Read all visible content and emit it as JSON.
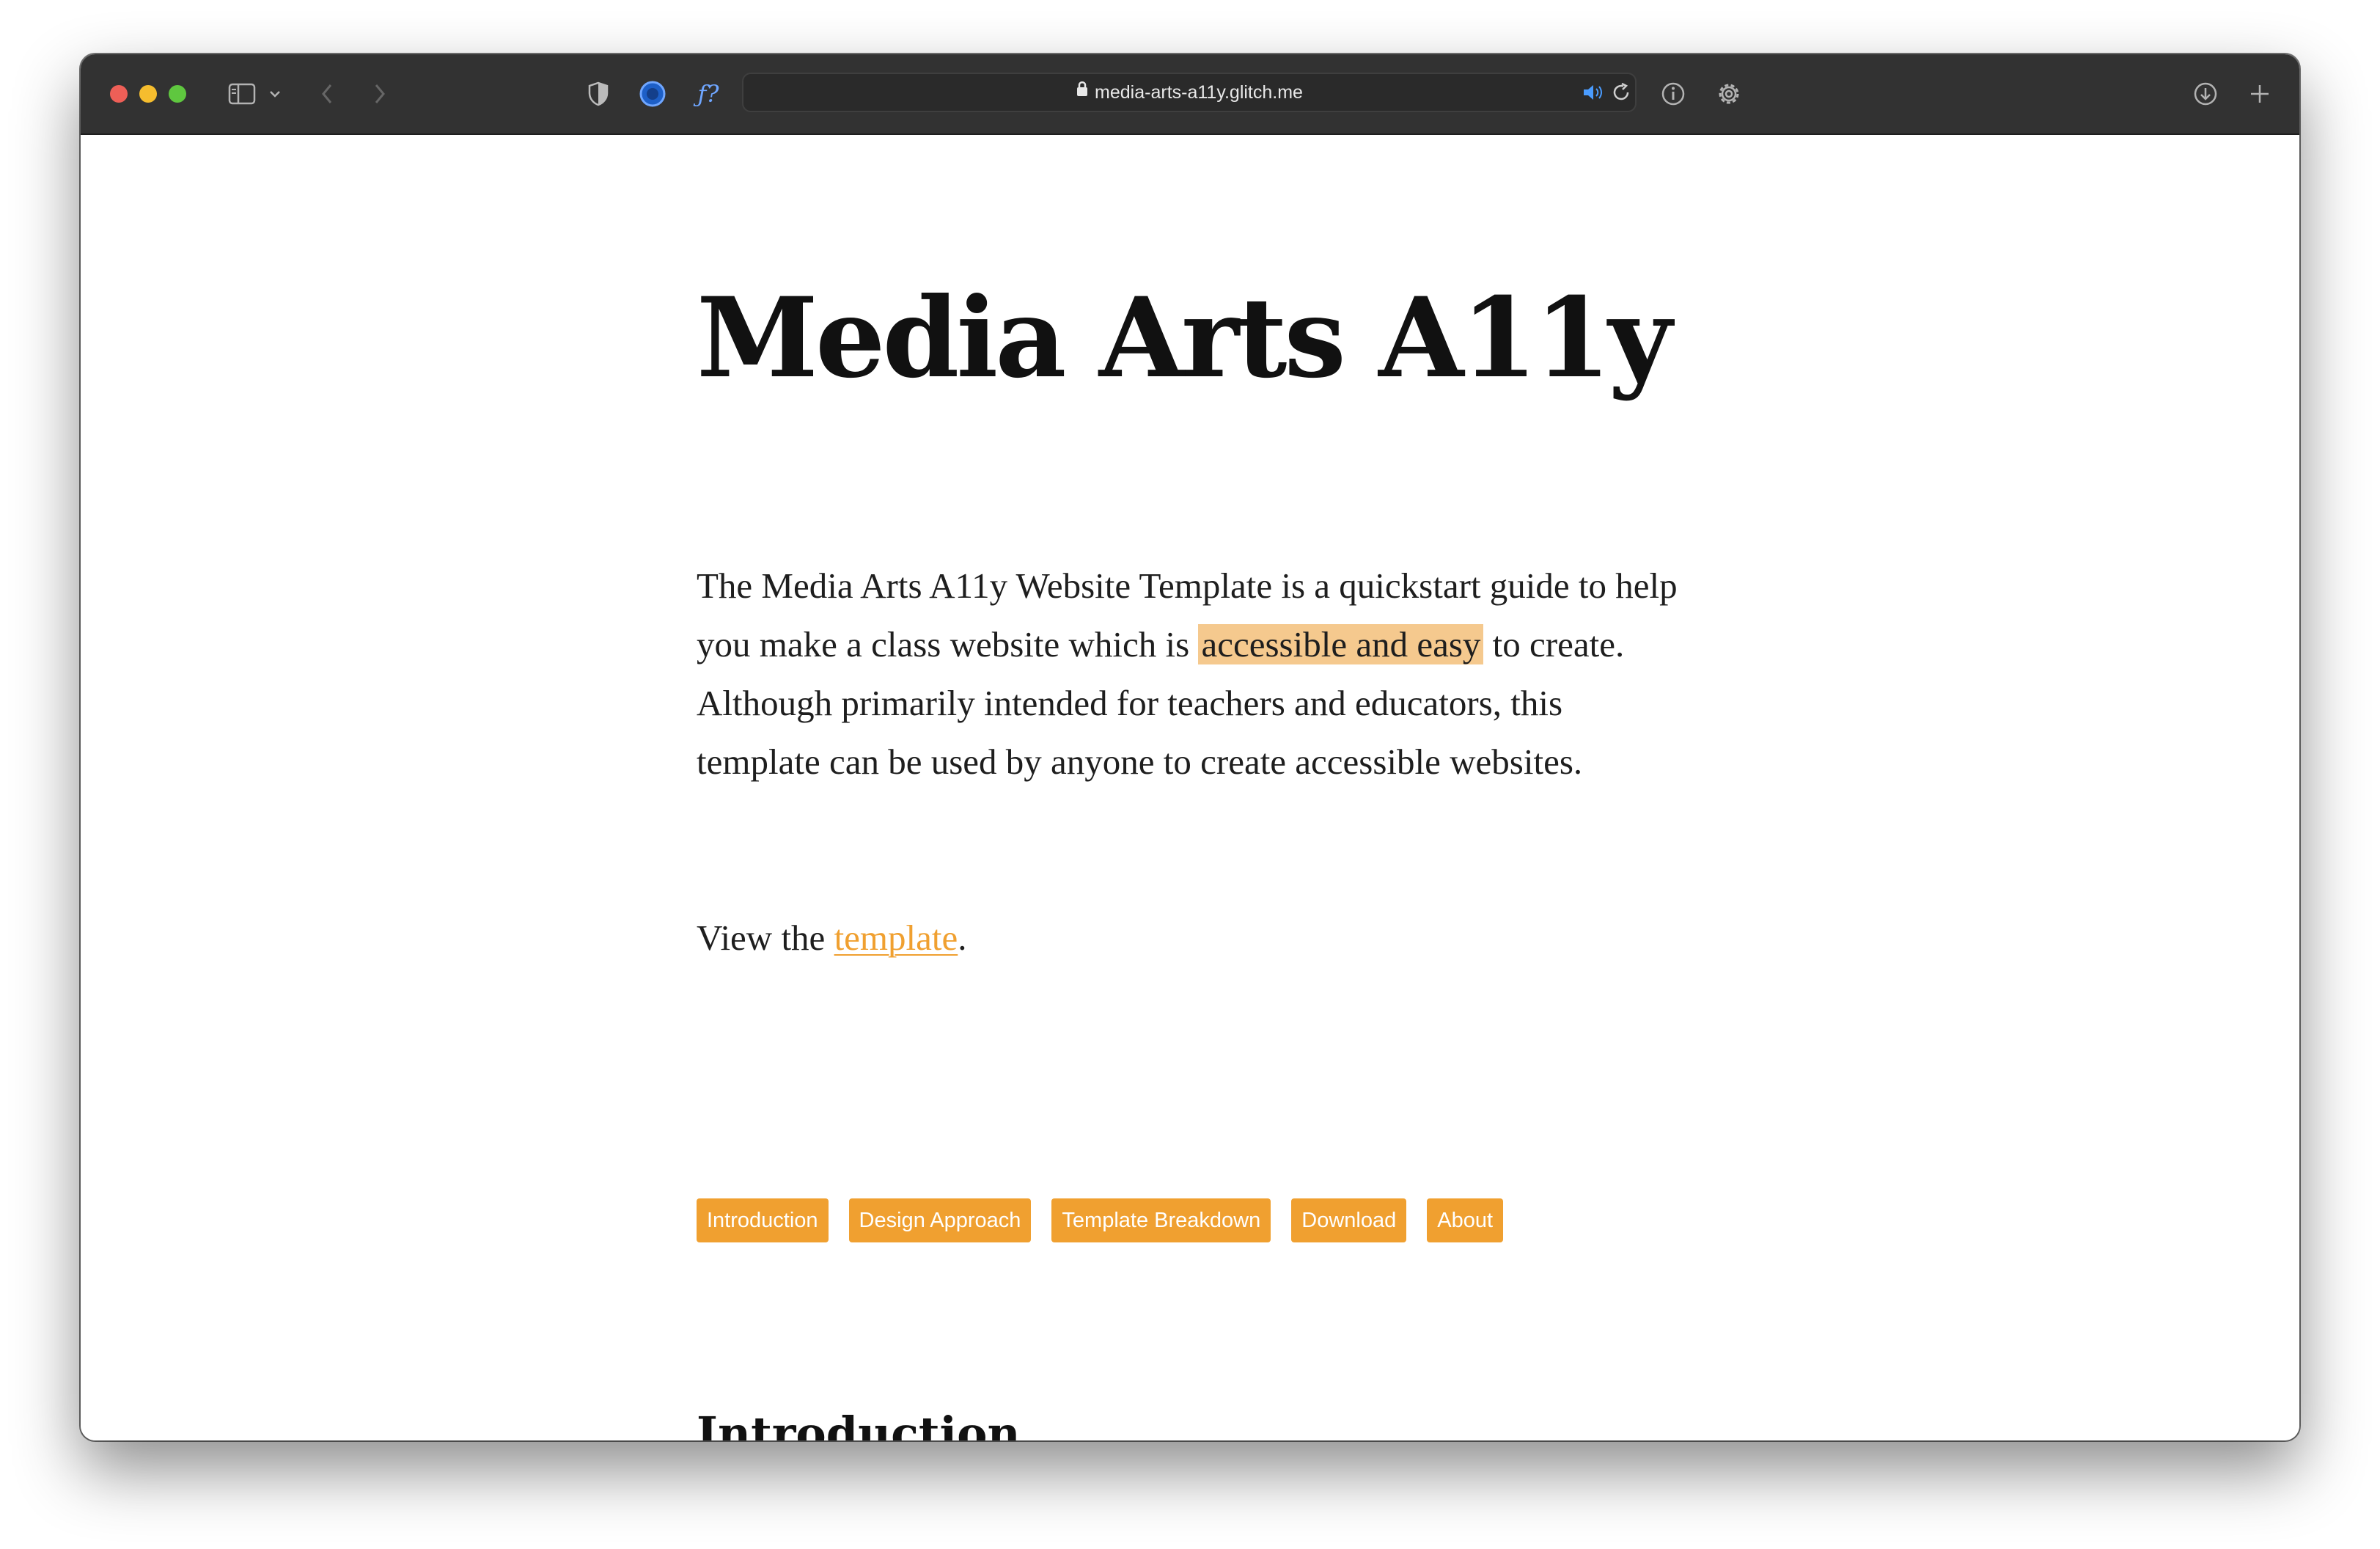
{
  "browser": {
    "url": "media-arts-a11y.glitch.me"
  },
  "page": {
    "title": "Media Arts A11y",
    "intro": {
      "before": "The Media Arts A11y Website Template is a quickstart guide to help you make a class website which is ",
      "highlight": "accessible and easy",
      "after": " to create. Although primarily intended for teachers and educators, this template can be used by anyone to create accessible websites."
    },
    "view": {
      "prefix": "View the ",
      "link": "template",
      "suffix": "."
    },
    "nav": [
      {
        "label": "Introduction"
      },
      {
        "label": "Design Approach"
      },
      {
        "label": "Template Breakdown"
      },
      {
        "label": "Download"
      },
      {
        "label": "About"
      }
    ],
    "section_heading": "Introduction"
  },
  "colors": {
    "accent": "#f0a030",
    "highlight": "#f5c98e",
    "titlebar": "#323232"
  },
  "icons": [
    "sidebar-icon",
    "chevron-down-icon",
    "back-icon",
    "forward-icon",
    "shield-icon",
    "extension-icon",
    "function-icon",
    "lock-icon",
    "speaker-icon",
    "reload-icon",
    "info-icon",
    "gear-icon",
    "download-icon",
    "plus-icon"
  ]
}
